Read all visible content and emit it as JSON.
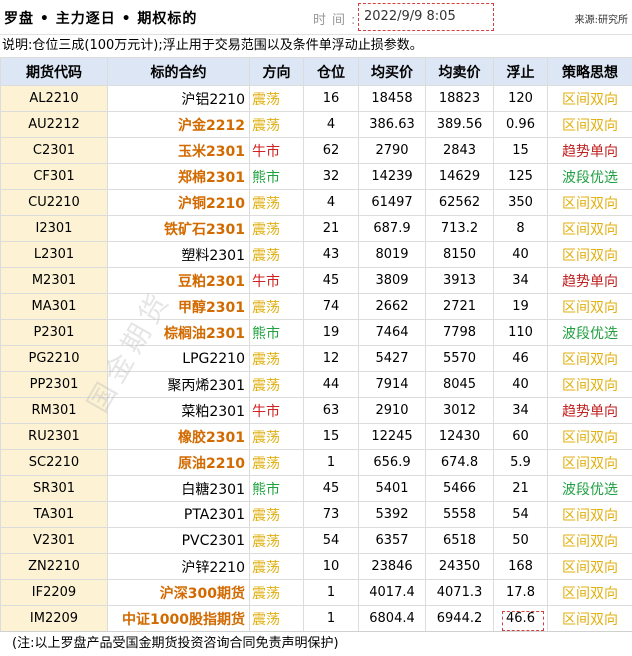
{
  "header": {
    "title": "罗盘 • 主力逐日 • 期权标的",
    "time_label": "时间:",
    "time_value": "2022/9/9 8:05",
    "source": "来源:研究所"
  },
  "note": "说明:仓位三成(100万元计);浮止用于交易范围以及条件单浮动止损参数。",
  "columns": [
    "期货代码",
    "标的合约",
    "方向",
    "仓位",
    "均买价",
    "均卖价",
    "浮止",
    "策略思想"
  ],
  "rows": [
    {
      "code": "AL2210",
      "name": "沪铝2210",
      "hl": false,
      "dir": "震荡",
      "pos": "16",
      "buy": "18458",
      "sell": "18823",
      "stop": "120",
      "strat": "区间双向"
    },
    {
      "code": "AU2212",
      "name": "沪金2212",
      "hl": true,
      "dir": "震荡",
      "pos": "4",
      "buy": "386.63",
      "sell": "389.56",
      "stop": "0.96",
      "strat": "区间双向"
    },
    {
      "code": "C2301",
      "name": "玉米2301",
      "hl": true,
      "dir": "牛市",
      "pos": "62",
      "buy": "2790",
      "sell": "2843",
      "stop": "15",
      "strat": "趋势单向"
    },
    {
      "code": "CF301",
      "name": "郑棉2301",
      "hl": true,
      "dir": "熊市",
      "pos": "32",
      "buy": "14239",
      "sell": "14629",
      "stop": "125",
      "strat": "波段优选"
    },
    {
      "code": "CU2210",
      "name": "沪铜2210",
      "hl": true,
      "dir": "震荡",
      "pos": "4",
      "buy": "61497",
      "sell": "62562",
      "stop": "350",
      "strat": "区间双向"
    },
    {
      "code": "I2301",
      "name": "铁矿石2301",
      "hl": true,
      "dir": "震荡",
      "pos": "21",
      "buy": "687.9",
      "sell": "713.2",
      "stop": "8",
      "strat": "区间双向"
    },
    {
      "code": "L2301",
      "name": "塑料2301",
      "hl": false,
      "dir": "震荡",
      "pos": "43",
      "buy": "8019",
      "sell": "8150",
      "stop": "40",
      "strat": "区间双向"
    },
    {
      "code": "M2301",
      "name": "豆粕2301",
      "hl": true,
      "dir": "牛市",
      "pos": "45",
      "buy": "3809",
      "sell": "3913",
      "stop": "34",
      "strat": "趋势单向"
    },
    {
      "code": "MA301",
      "name": "甲醇2301",
      "hl": true,
      "dir": "震荡",
      "pos": "74",
      "buy": "2662",
      "sell": "2721",
      "stop": "19",
      "strat": "区间双向"
    },
    {
      "code": "P2301",
      "name": "棕榈油2301",
      "hl": true,
      "dir": "熊市",
      "pos": "19",
      "buy": "7464",
      "sell": "7798",
      "stop": "110",
      "strat": "波段优选"
    },
    {
      "code": "PG2210",
      "name": "LPG2210",
      "hl": false,
      "dir": "震荡",
      "pos": "12",
      "buy": "5427",
      "sell": "5570",
      "stop": "46",
      "strat": "区间双向"
    },
    {
      "code": "PP2301",
      "name": "聚丙烯2301",
      "hl": false,
      "dir": "震荡",
      "pos": "44",
      "buy": "7914",
      "sell": "8045",
      "stop": "40",
      "strat": "区间双向"
    },
    {
      "code": "RM301",
      "name": "菜粕2301",
      "hl": false,
      "dir": "牛市",
      "pos": "63",
      "buy": "2910",
      "sell": "3012",
      "stop": "34",
      "strat": "趋势单向"
    },
    {
      "code": "RU2301",
      "name": "橡胶2301",
      "hl": true,
      "dir": "震荡",
      "pos": "15",
      "buy": "12245",
      "sell": "12430",
      "stop": "60",
      "strat": "区间双向"
    },
    {
      "code": "SC2210",
      "name": "原油2210",
      "hl": true,
      "dir": "震荡",
      "pos": "1",
      "buy": "656.9",
      "sell": "674.8",
      "stop": "5.9",
      "strat": "区间双向"
    },
    {
      "code": "SR301",
      "name": "白糖2301",
      "hl": false,
      "dir": "熊市",
      "pos": "45",
      "buy": "5401",
      "sell": "5466",
      "stop": "21",
      "strat": "波段优选"
    },
    {
      "code": "TA301",
      "name": "PTA2301",
      "hl": false,
      "dir": "震荡",
      "pos": "73",
      "buy": "5392",
      "sell": "5558",
      "stop": "54",
      "strat": "区间双向"
    },
    {
      "code": "V2301",
      "name": "PVC2301",
      "hl": false,
      "dir": "震荡",
      "pos": "54",
      "buy": "6357",
      "sell": "6518",
      "stop": "50",
      "strat": "区间双向"
    },
    {
      "code": "ZN2210",
      "name": "沪锌2210",
      "hl": false,
      "dir": "震荡",
      "pos": "10",
      "buy": "23846",
      "sell": "24350",
      "stop": "168",
      "strat": "区间双向"
    },
    {
      "code": "IF2209",
      "name": "沪深300期货",
      "hl": true,
      "dir": "震荡",
      "pos": "1",
      "buy": "4017.4",
      "sell": "4071.3",
      "stop": "17.8",
      "strat": "区间双向"
    },
    {
      "code": "IM2209",
      "name": "中证1000股指期货",
      "hl": true,
      "dir": "震荡",
      "pos": "1",
      "buy": "6804.4",
      "sell": "6944.2",
      "stop": "46.6",
      "strat": "区间双向"
    }
  ],
  "footer": "(注:以上罗盘产品受国金期货投资咨询合同免责声明保护)",
  "watermark": "国金期货",
  "colors": {
    "range": "#e0b010",
    "bull": "#d02020",
    "bear": "#20a040",
    "highlight": "#d26a00",
    "code_bg": "#fdf3d4",
    "header_bg": "#dde6f4"
  }
}
